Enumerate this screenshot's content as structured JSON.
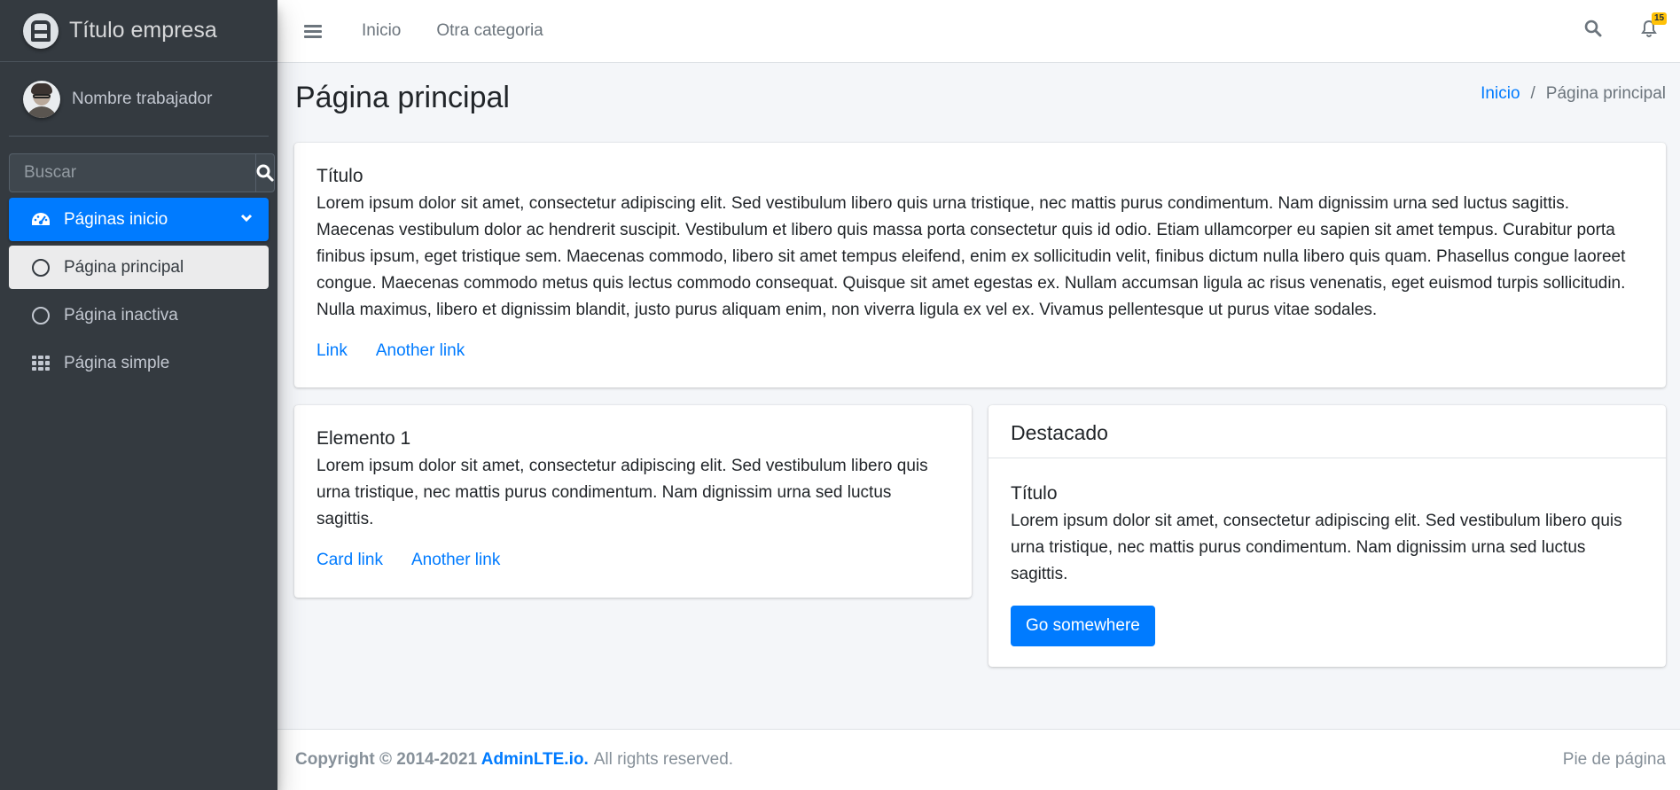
{
  "brand": {
    "title": "Título empresa"
  },
  "user": {
    "name": "Nombre trabajador"
  },
  "search": {
    "placeholder": "Buscar"
  },
  "sidebar": {
    "items": [
      {
        "label": "Páginas inicio"
      },
      {
        "label": "Página principal"
      },
      {
        "label": "Página inactiva"
      },
      {
        "label": "Página simple"
      }
    ]
  },
  "navbar": {
    "links": [
      "Inicio",
      "Otra categoria"
    ],
    "notifications_count": "15"
  },
  "page": {
    "title": "Página principal",
    "breadcrumb": [
      "Inicio",
      "Página principal"
    ]
  },
  "card1": {
    "title": "Título",
    "text": "Lorem ipsum dolor sit amet, consectetur adipiscing elit. Sed vestibulum libero quis urna tristique, nec mattis purus condimentum. Nam dignissim urna sed luctus sagittis. Maecenas vestibulum dolor ac hendrerit suscipit. Vestibulum et libero quis massa porta consectetur quis id odio. Etiam ullamcorper eu sapien sit amet tempus. Curabitur porta finibus ipsum, eget tristique sem. Maecenas commodo, libero sit amet tempus eleifend, enim ex sollicitudin velit, finibus dictum nulla libero quis quam. Phasellus congue laoreet congue. Maecenas commodo metus quis lectus commodo consequat. Quisque sit amet egestas ex. Nullam accumsan ligula ac risus venenatis, eget euismod turpis sollicitudin. Nulla maximus, libero et dignissim blandit, justo purus aliquam enim, non viverra ligula ex vel ex. Vivamus pellentesque ut purus vitae sodales.",
    "links": [
      "Link",
      "Another link"
    ]
  },
  "card2": {
    "title": "Elemento 1",
    "text": "Lorem ipsum dolor sit amet, consectetur adipiscing elit. Sed vestibulum libero quis urna tristique, nec mattis purus condimentum. Nam dignissim urna sed luctus sagittis.",
    "links": [
      "Card link",
      "Another link"
    ]
  },
  "card3": {
    "header": "Destacado",
    "title": "Título",
    "text": "Lorem ipsum dolor sit amet, consectetur adipiscing elit. Sed vestibulum libero quis urna tristique, nec mattis purus condimentum. Nam dignissim urna sed luctus sagittis.",
    "button": "Go somewhere"
  },
  "footer": {
    "copyright": "Copyright © 2014-2021",
    "brand_link": "AdminLTE.io.",
    "rights": "All rights reserved.",
    "right_text": "Pie de página"
  },
  "colors": {
    "primary": "#007bff",
    "sidebar_bg": "#343a40",
    "badge": "#ffc107"
  }
}
